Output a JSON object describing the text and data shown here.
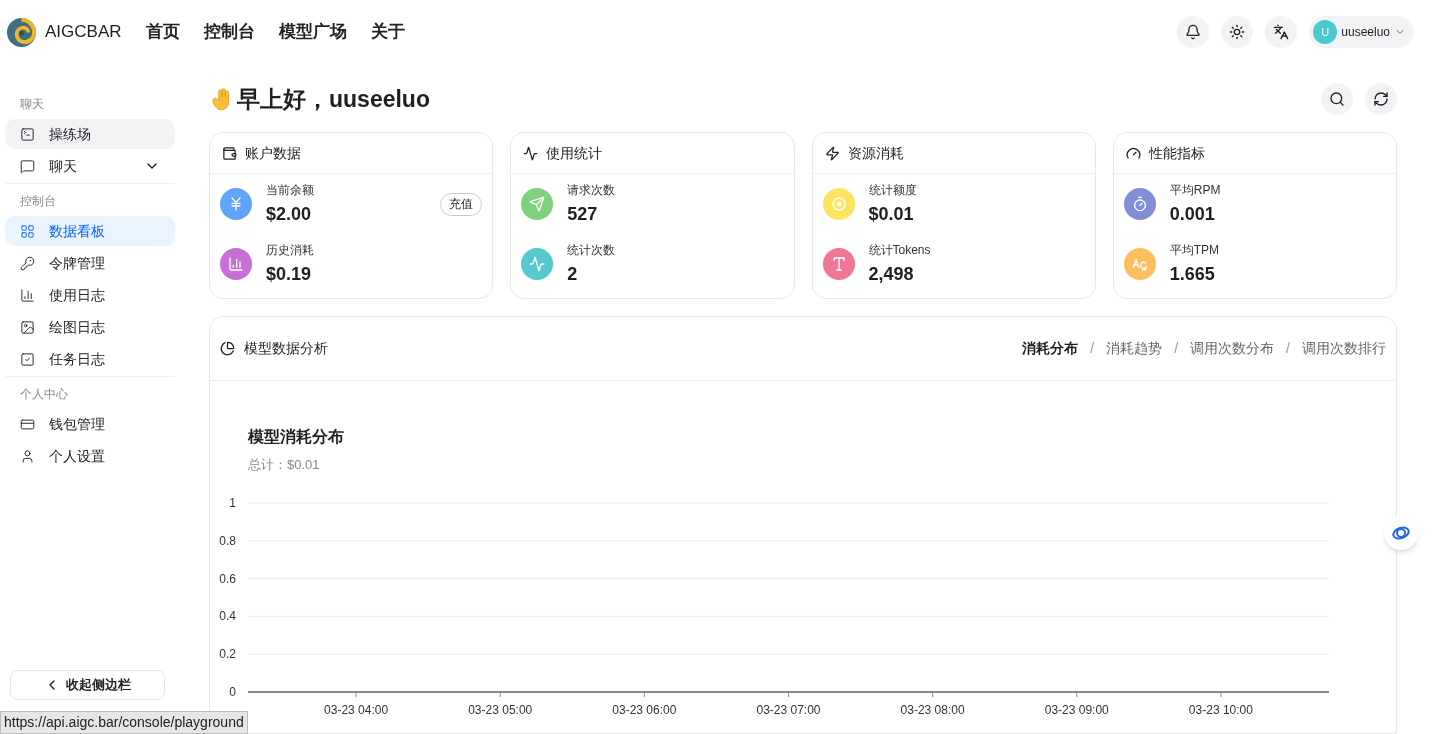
{
  "header": {
    "brand": "AIGCBAR",
    "nav": [
      {
        "label": "首页"
      },
      {
        "label": "控制台"
      },
      {
        "label": "模型广场"
      },
      {
        "label": "关于"
      }
    ],
    "user": {
      "initial": "U",
      "name": "uuseeluo"
    }
  },
  "sidebar": {
    "sections": [
      {
        "title": "聊天",
        "items": [
          {
            "label": "操练场",
            "kind": "link",
            "selected": false,
            "hovered": true
          },
          {
            "label": "聊天",
            "kind": "group",
            "expanded": false,
            "selected": false,
            "hovered": false
          }
        ]
      },
      {
        "title": "控制台",
        "items": [
          {
            "label": "数据看板",
            "kind": "link",
            "selected": true,
            "hovered": false
          },
          {
            "label": "令牌管理",
            "kind": "link",
            "selected": false,
            "hovered": false
          },
          {
            "label": "使用日志",
            "kind": "link",
            "selected": false,
            "hovered": false
          },
          {
            "label": "绘图日志",
            "kind": "link",
            "selected": false,
            "hovered": false
          },
          {
            "label": "任务日志",
            "kind": "link",
            "selected": false,
            "hovered": false
          }
        ]
      },
      {
        "title": "个人中心",
        "items": [
          {
            "label": "钱包管理",
            "kind": "link",
            "selected": false,
            "hovered": false
          },
          {
            "label": "个人设置",
            "kind": "link",
            "selected": false,
            "hovered": false
          }
        ]
      }
    ],
    "collapse_button": "收起侧边栏"
  },
  "greeting": "早上好，uuseeluo",
  "cards": [
    {
      "title": "账户数据",
      "stats": [
        {
          "label": "当前余额",
          "value": "$2.00",
          "color": "#60a5fa",
          "action": "充值"
        },
        {
          "label": "历史消耗",
          "value": "$0.19",
          "color": "#c86fd6"
        }
      ]
    },
    {
      "title": "使用统计",
      "stats": [
        {
          "label": "请求次数",
          "value": "527",
          "color": "#7dd17f"
        },
        {
          "label": "统计次数",
          "value": "2",
          "color": "#56c9d0"
        }
      ]
    },
    {
      "title": "资源消耗",
      "stats": [
        {
          "label": "统计额度",
          "value": "$0.01",
          "color": "#fde45f"
        },
        {
          "label": "统计Tokens",
          "value": "2,498",
          "color": "#f07597"
        }
      ]
    },
    {
      "title": "性能指标",
      "stats": [
        {
          "label": "平均RPM",
          "value": "0.001",
          "color": "#8190d6"
        },
        {
          "label": "平均TPM",
          "value": "1.665",
          "color": "#fbbf5e"
        }
      ]
    }
  ],
  "analysis": {
    "title": "模型数据分析",
    "separator": "/",
    "tabs": [
      {
        "label": "消耗分布",
        "selected": true
      },
      {
        "label": "消耗趋势",
        "selected": false
      },
      {
        "label": "调用次数分布",
        "selected": false
      },
      {
        "label": "调用次数排行",
        "selected": false
      }
    ],
    "chart_title": "模型消耗分布",
    "total": "总计：$0.01",
    "chart_data": {
      "type": "bar",
      "grid": true,
      "categories": [
        "03-23 04:00",
        "03-23 05:00",
        "03-23 06:00",
        "03-23 07:00",
        "03-23 08:00",
        "03-23 09:00",
        "03-23 10:00"
      ],
      "ylim": [
        0,
        1
      ],
      "yticks": [
        0,
        0.2,
        0.4,
        0.6,
        0.8,
        1
      ],
      "series": [
        {
          "values": [
            null,
            null,
            null,
            null,
            null,
            null,
            null
          ]
        }
      ]
    }
  },
  "status_url": "https://api.aigc.bar/console/playground"
}
